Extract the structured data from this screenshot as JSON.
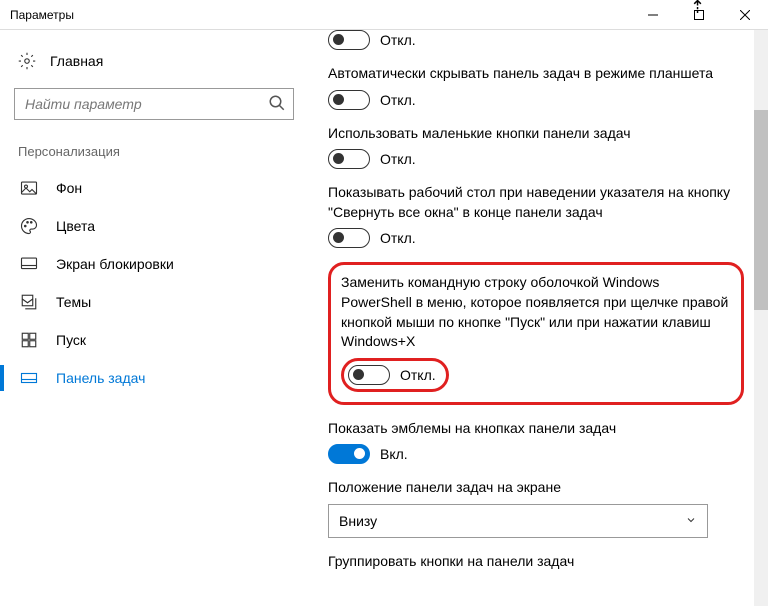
{
  "window": {
    "title": "Параметры"
  },
  "sidebar": {
    "home": "Главная",
    "search_placeholder": "Найти параметр",
    "category": "Персонализация",
    "items": [
      {
        "label": "Фон"
      },
      {
        "label": "Цвета"
      },
      {
        "label": "Экран блокировки"
      },
      {
        "label": "Темы"
      },
      {
        "label": "Пуск"
      },
      {
        "label": "Панель задач"
      }
    ]
  },
  "states": {
    "off": "Откл.",
    "on": "Вкл."
  },
  "settings": {
    "s0": {
      "state": "Откл."
    },
    "s1": {
      "label": "Автоматически скрывать панель задач в режиме планшета",
      "state": "Откл."
    },
    "s2": {
      "label": "Использовать маленькие кнопки панели задач",
      "state": "Откл."
    },
    "s3": {
      "label": "Показывать рабочий стол при наведении указателя на кнопку \"Свернуть все окна\" в конце панели задач",
      "state": "Откл."
    },
    "s4": {
      "label": "Заменить командную строку оболочкой Windows PowerShell в меню, которое появляется при щелчке правой кнопкой мыши по кнопке \"Пуск\" или при нажатии клавиш Windows+X",
      "state": "Откл."
    },
    "s5": {
      "label": "Показать эмблемы на кнопках панели задач",
      "state": "Вкл."
    },
    "s6": {
      "label": "Положение панели задач на экране",
      "value": "Внизу"
    },
    "s7": {
      "label": "Группировать кнопки на панели задач"
    }
  }
}
